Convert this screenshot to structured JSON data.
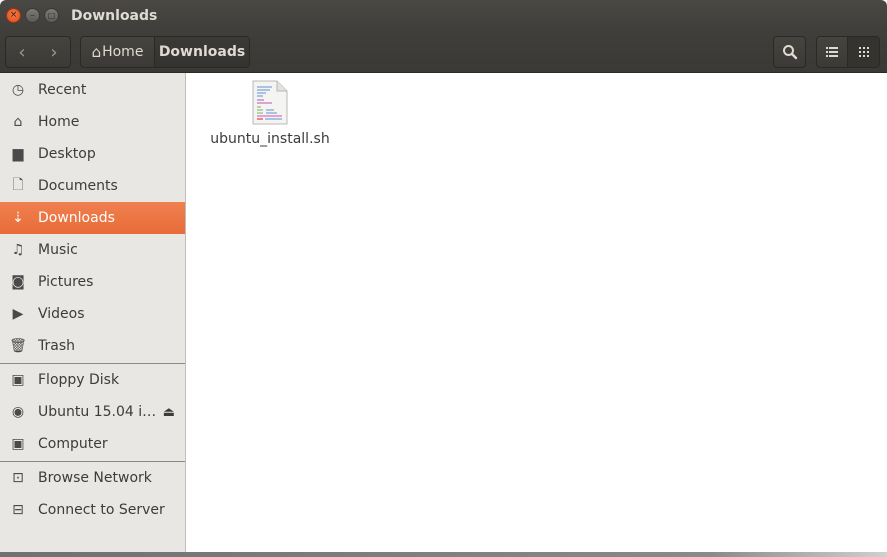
{
  "window": {
    "title": "Downloads",
    "controls": {
      "close": "×",
      "minimize": "–",
      "maximize": "□"
    }
  },
  "toolbar": {
    "back_icon": "‹",
    "forward_icon": "›",
    "breadcrumb": [
      {
        "label": "Home",
        "icon": "⌂"
      },
      {
        "label": "Downloads"
      }
    ],
    "search_icon": "🔍",
    "list_view_icon": "☰",
    "grid_view_icon": "⠿"
  },
  "sidebar": {
    "places": [
      {
        "label": "Recent",
        "icon": "◷"
      },
      {
        "label": "Home",
        "icon": "⌂"
      },
      {
        "label": "Desktop",
        "icon": "▆"
      },
      {
        "label": "Documents",
        "icon": "🗋"
      },
      {
        "label": "Downloads",
        "icon": "⇣",
        "active": true
      },
      {
        "label": "Music",
        "icon": "♫"
      },
      {
        "label": "Pictures",
        "icon": "◙"
      },
      {
        "label": "Videos",
        "icon": "▶"
      },
      {
        "label": "Trash",
        "icon": "🗑"
      }
    ],
    "devices": [
      {
        "label": "Floppy Disk",
        "icon": "▣"
      },
      {
        "label": "Ubuntu 15.04 i…",
        "icon": "◉",
        "eject": "⏏"
      },
      {
        "label": "Computer",
        "icon": "▣"
      }
    ],
    "network": [
      {
        "label": "Browse Network",
        "icon": "⊡"
      },
      {
        "label": "Connect to Server",
        "icon": "⊟"
      }
    ]
  },
  "content": {
    "files": [
      {
        "name": "ubuntu_install.sh",
        "type": "shell-script"
      }
    ]
  }
}
